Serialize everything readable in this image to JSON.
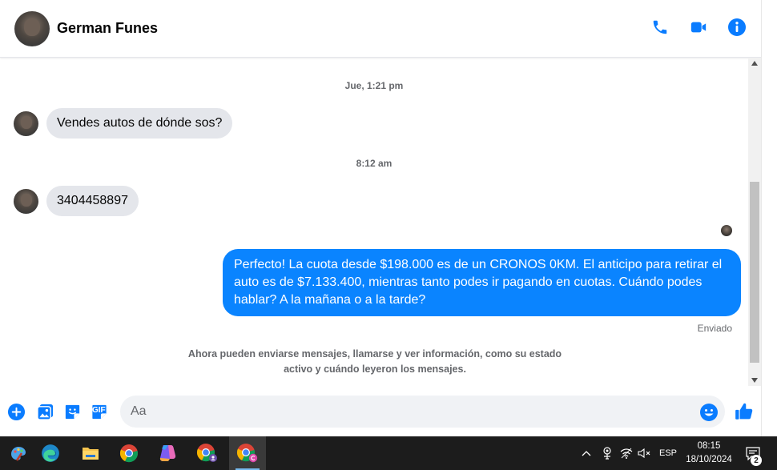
{
  "header": {
    "contact_name": "German Funes",
    "actions": [
      {
        "icon": "phone-icon"
      },
      {
        "icon": "video-camera-icon"
      },
      {
        "icon": "info-icon"
      }
    ]
  },
  "conversation": {
    "timestamp_1": "Jue, 1:21 pm",
    "message_1": "Vendes autos de dónde sos?",
    "timestamp_2": "8:12 am",
    "message_2": "3404458897",
    "outgoing_message": "Perfecto! La cuota desde $198.000 es de un CRONOS 0KM. El anticipo para retirar el auto es de $7.133.400, mientras tanto podes ir pagando en cuotas. Cuándo podes hablar? A la mañana o a la tarde?",
    "status": "Enviado",
    "info_line_1": "Ahora pueden enviarse mensajes, llamarse y ver información, como su estado",
    "info_line_2": "activo y cuándo leyeron los mensajes."
  },
  "composer": {
    "placeholder": "Aa",
    "buttons": [
      "plus-icon",
      "gallery-icon",
      "sticker-icon",
      "gif-icon"
    ],
    "gif_label": "GIF"
  },
  "taskbar": {
    "apps": [
      "paint-icon",
      "edge-icon",
      "file-explorer-icon",
      "chrome-icon",
      "copilot-icon",
      "chrome-profile-icon",
      "chrome-profile-c-icon"
    ],
    "language": "ESP",
    "time": "08:15",
    "date": "18/10/2024",
    "notification_count": "2"
  },
  "colors": {
    "accent": "#0a84ff",
    "incoming_bubble": "#e4e6eb",
    "taskbar": "#1c1c1c"
  }
}
